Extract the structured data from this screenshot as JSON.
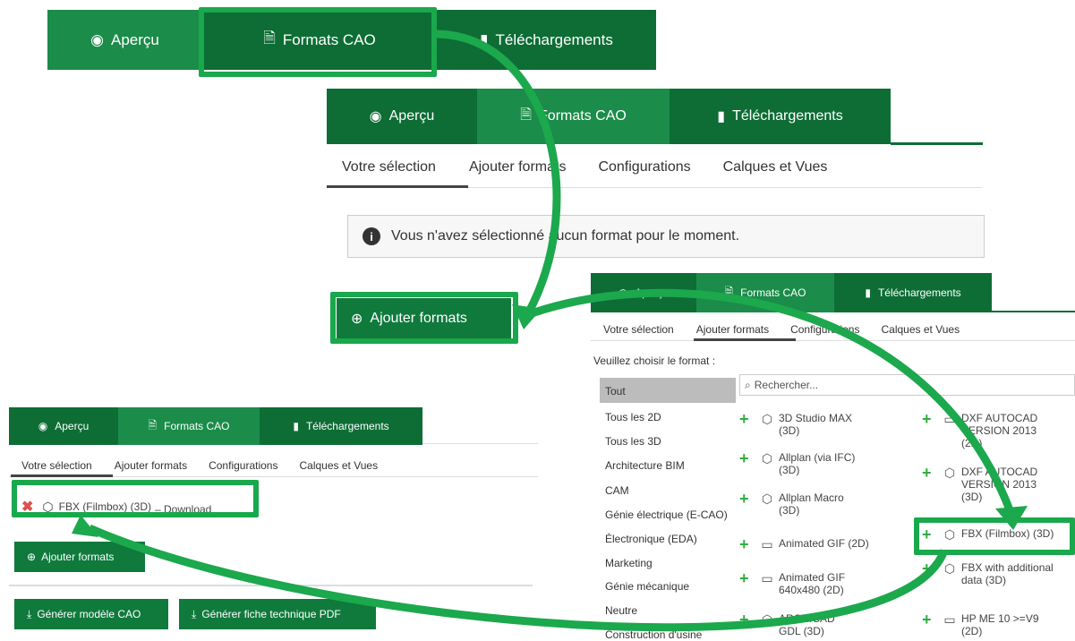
{
  "tabs": {
    "preview": "Aperçu",
    "cad": "Formats CAO",
    "downloads": "Téléchargements"
  },
  "subtabs": {
    "selection": "Votre sélection",
    "add": "Ajouter formats",
    "configs": "Configurations",
    "layers": "Calques et Vues"
  },
  "notice": "Vous n'avez sélectionné aucun format pour le moment.",
  "add_button": "Ajouter formats",
  "choose_label": "Veuillez choisir le format :",
  "search_placeholder": "Rechercher...",
  "categories": [
    "Tout",
    "Tous les 2D",
    "Tous les 3D",
    "Architecture BIM",
    "CAM",
    "Génie électrique (E-CAO)",
    "Électronique (EDA)",
    "Marketing",
    "Génie mécanique",
    "Neutre",
    "Construction d'usine"
  ],
  "formats_col1": [
    {
      "label": "3D Studio MAX (3D)",
      "icon": "cube-icon"
    },
    {
      "label": "Allplan (via IFC) (3D)",
      "icon": "cube-icon"
    },
    {
      "label": "Allplan Macro (3D)",
      "icon": "cube-icon"
    },
    {
      "label": "Animated GIF (2D)",
      "icon": "drawing-icon"
    },
    {
      "label": "Animated GIF 640x480 (2D)",
      "icon": "drawing-icon"
    },
    {
      "label": "ARCHICAD GDL (3D)",
      "icon": "cube-icon"
    }
  ],
  "formats_col2": [
    {
      "label": "DXF AUTOCAD VERSION 2013 (2D)",
      "icon": "drawing-icon"
    },
    {
      "label": "DXF AUTOCAD VERSION 2013 (3D)",
      "icon": "cube-icon"
    },
    {
      "label": "FBX (Filmbox) (3D)",
      "icon": "cube-icon"
    },
    {
      "label": "FBX with additional data (3D)",
      "icon": "cube-icon"
    },
    {
      "label": "HP ME 10 >=V9 (2D)",
      "icon": "drawing-icon"
    }
  ],
  "selected_item": "FBX (Filmbox) (3D)",
  "selected_suffix": "– Download",
  "generate_cad": "Générer modèle CAO",
  "generate_pdf": "Générer fiche technique PDF",
  "colors": {
    "tab_dark": "#0d6d35",
    "tab_mid": "#1b8c4a",
    "highlight": "#19a84c",
    "button": "#0f7a3c"
  }
}
